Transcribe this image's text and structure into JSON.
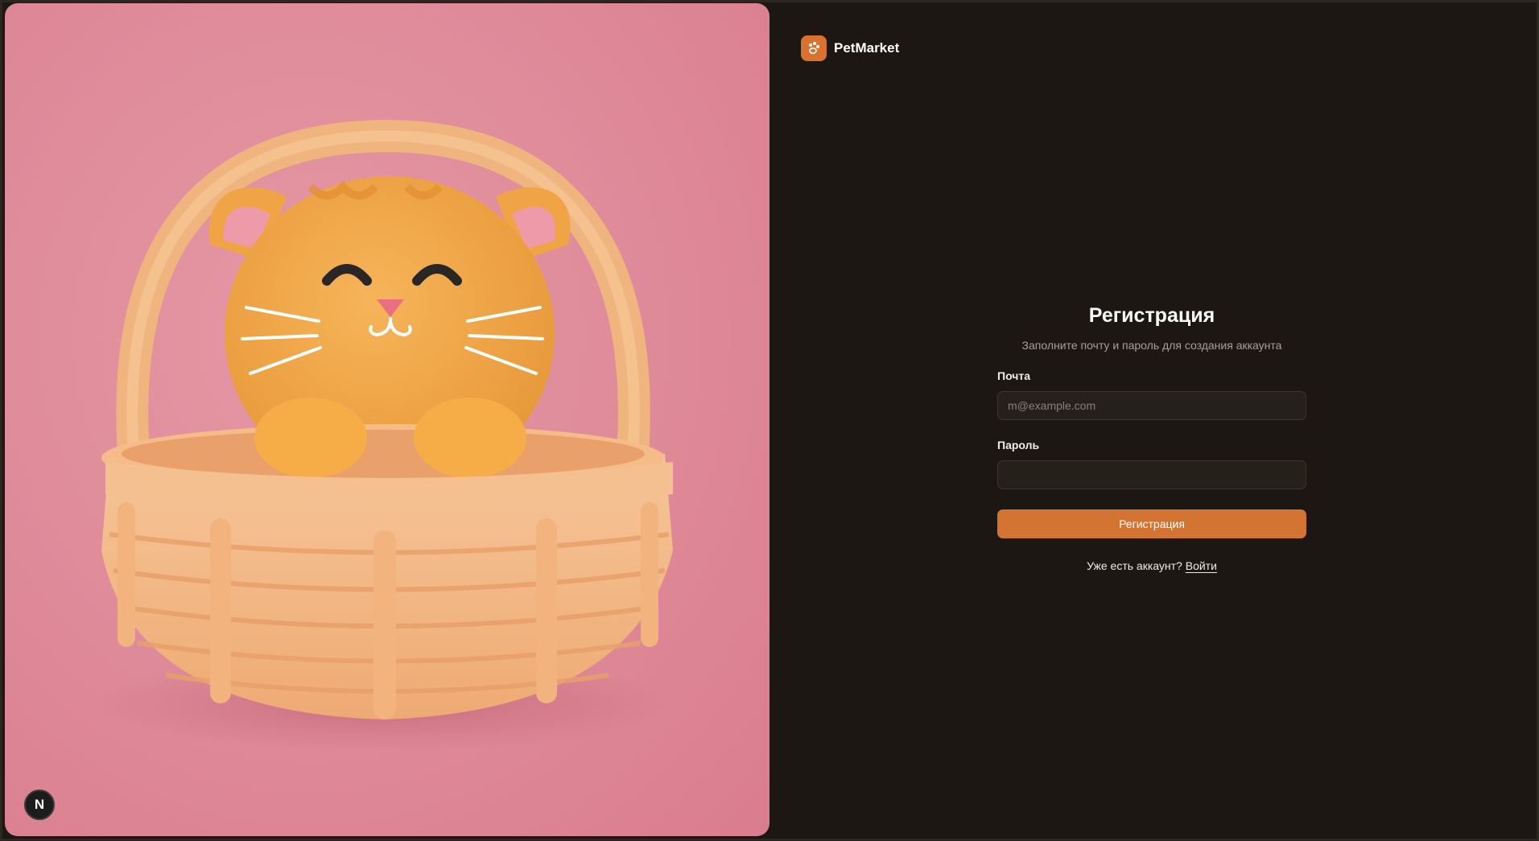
{
  "brand": {
    "name": "PetMarket",
    "logo_icon": "paw-icon",
    "accent": "#d9722f"
  },
  "hero": {
    "image": "kitten-in-basket-illustration",
    "badge_letter": "N"
  },
  "form": {
    "title": "Регистрация",
    "subtitle": "Заполните почту и пароль для создания аккаунта",
    "email_label": "Почта",
    "email_placeholder": "m@example.com",
    "email_value": "",
    "password_label": "Пароль",
    "password_value": "",
    "submit_label": "Регистрация",
    "login_prompt": "Уже есть аккаунт?",
    "login_link": "Войти"
  },
  "colors": {
    "background": "#1c1712",
    "hero_bg": "#e08c9b",
    "button": "#d37433"
  }
}
